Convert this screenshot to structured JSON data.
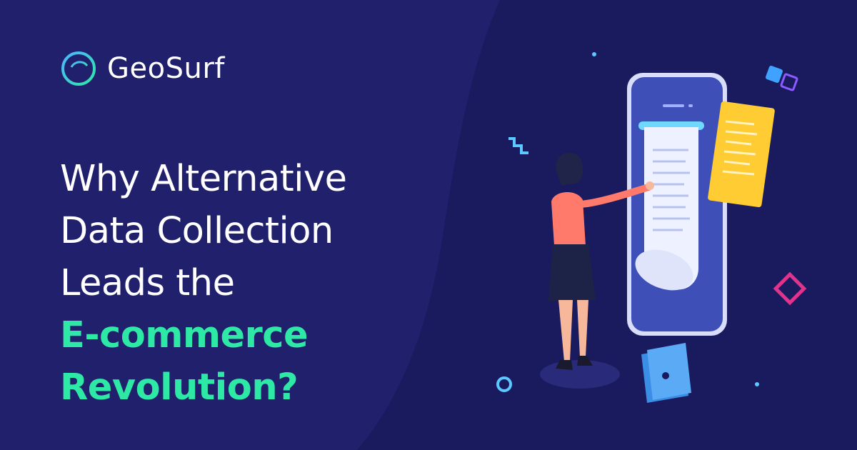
{
  "brand": {
    "name": "GeoSurf",
    "colors": {
      "background": "#1a1a5e",
      "panel": "#20206d",
      "accent": "#2ee8a6",
      "text": "#ffffff"
    }
  },
  "headline": {
    "lines": [
      "Why Alternative",
      "Data Collection",
      "Leads the"
    ],
    "accent_lines": [
      "E-commerce",
      "Revolution?"
    ]
  },
  "illustration": {
    "icons": [
      "phone-icon",
      "receipt-icon",
      "woman-figure",
      "document-card-icon",
      "wallet-icon",
      "cube-icon",
      "diamond-icon",
      "zigzag-icon",
      "ring-icon"
    ]
  }
}
